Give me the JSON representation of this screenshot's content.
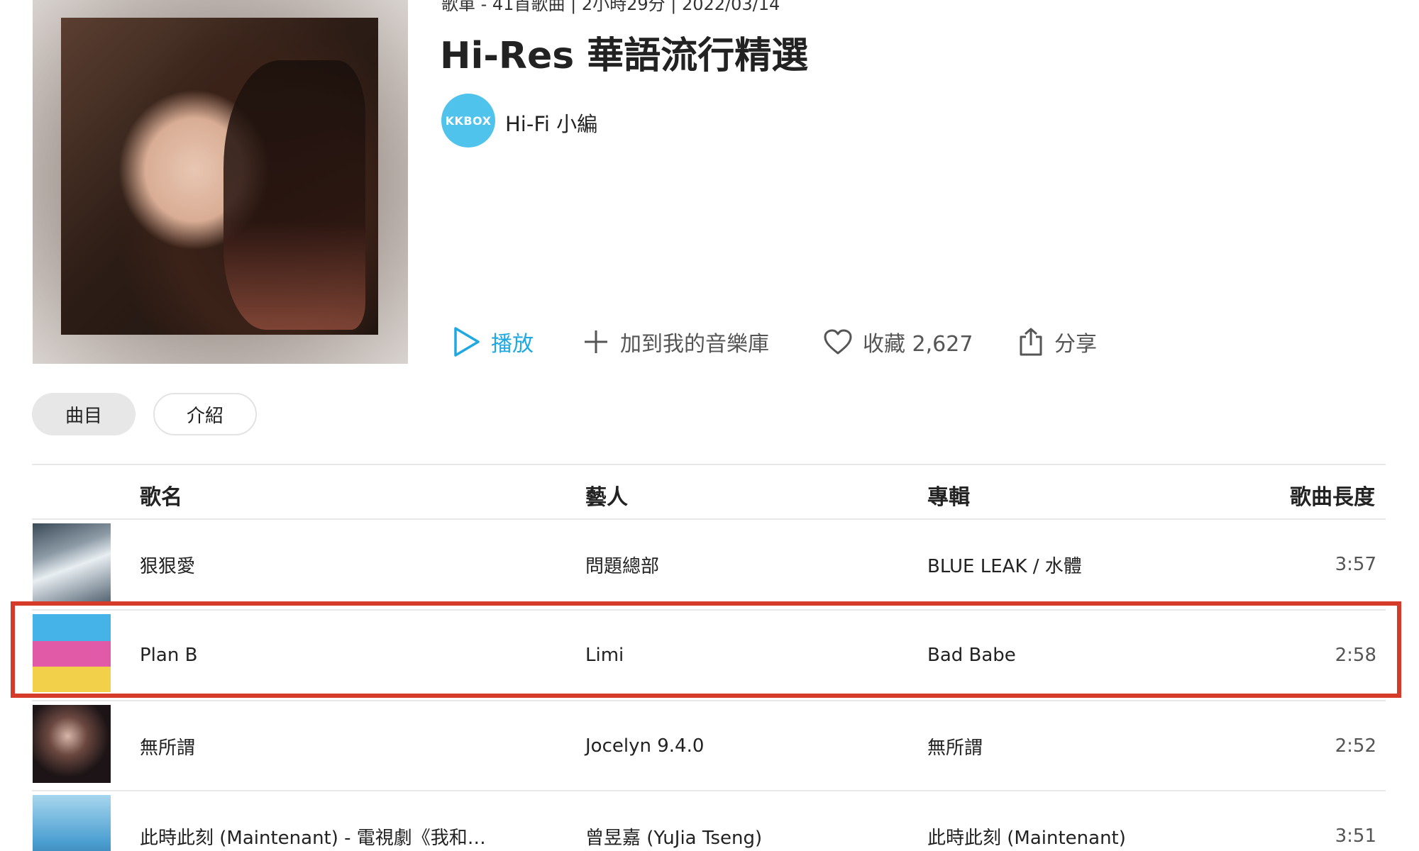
{
  "playlist": {
    "meta": "歌單 - 41首歌曲 | 2小時29分 | 2022/03/14",
    "title": "Hi-Res 華語流行精選",
    "owner_avatar_text": "KKBOX",
    "owner_name": "Hi-Fi 小編"
  },
  "actions": {
    "play": "播放",
    "add_to_library": "加到我的音樂庫",
    "favorite": "收藏 2,627",
    "share": "分享"
  },
  "tabs": [
    "曲目",
    "介紹"
  ],
  "table": {
    "headers": {
      "song": "歌名",
      "artist": "藝人",
      "album": "專輯",
      "length": "歌曲長度"
    },
    "rows": [
      {
        "song": "狠狠愛",
        "artist": "問題總部",
        "album": "BLUE LEAK / 水體",
        "length": "3:57"
      },
      {
        "song": "Plan B",
        "artist": "Limi",
        "album": "Bad Babe",
        "length": "2:58"
      },
      {
        "song": "無所謂",
        "artist": "Jocelyn 9.4.0",
        "album": "無所謂",
        "length": "2:52"
      },
      {
        "song": "此時此刻 (Maintenant) - 電視劇《我和…",
        "artist": "曾昱嘉 (YuJia Tseng)",
        "album": "此時此刻 (Maintenant)",
        "length": "3:51"
      }
    ]
  },
  "colors": {
    "accent": "#1fa9e0",
    "highlight": "#d63b2a",
    "kkbox": "#4fc3ec"
  }
}
